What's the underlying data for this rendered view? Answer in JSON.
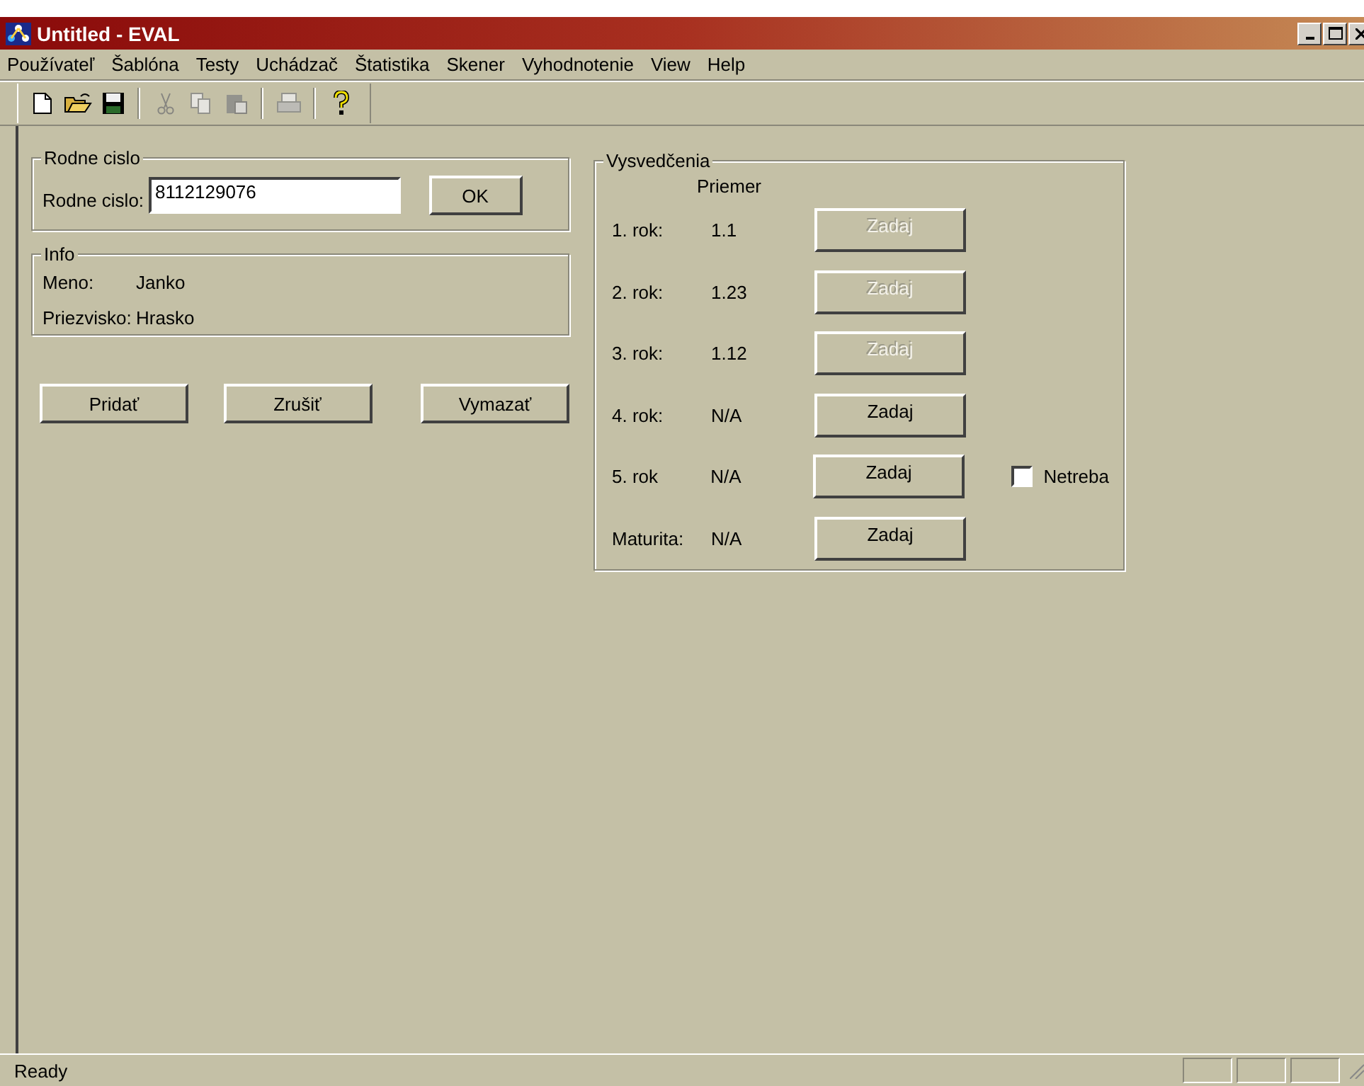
{
  "window": {
    "title": "Untitled - EVAL"
  },
  "menu": [
    "Používateľ",
    "Šablóna",
    "Testy",
    "Uchádzač",
    "Štatistika",
    "Skener",
    "Vyhodnotenie",
    "View",
    "Help"
  ],
  "toolbar": [
    {
      "kind": "new",
      "disabled": false
    },
    {
      "kind": "open",
      "disabled": false
    },
    {
      "kind": "save",
      "disabled": false
    },
    {
      "kind": "cut",
      "disabled": true
    },
    {
      "kind": "copy",
      "disabled": true
    },
    {
      "kind": "paste",
      "disabled": true
    },
    {
      "kind": "print",
      "disabled": true
    },
    {
      "kind": "help",
      "disabled": false
    }
  ],
  "rodne_cislo": {
    "title": "Rodne cislo",
    "label": "Rodne cislo:",
    "value": "8112129076",
    "button": "OK"
  },
  "info": {
    "title": "Info",
    "fields": [
      {
        "label": "Meno:",
        "value": "Janko"
      },
      {
        "label": "Priezvisko:",
        "value": "Hrasko"
      }
    ]
  },
  "actions": [
    "Pridať",
    "Zrušiť",
    "Vymazať"
  ],
  "vysvedcenia": {
    "title": "Vysvedčenia",
    "column": "Priemer",
    "rows": [
      {
        "label": "1. rok:",
        "value": "1.1",
        "button": "Zadaj",
        "disabled": true
      },
      {
        "label": "2. rok:",
        "value": "1.23",
        "button": "Zadaj",
        "disabled": true
      },
      {
        "label": "3. rok:",
        "value": "1.12",
        "button": "Zadaj",
        "disabled": true
      },
      {
        "label": "4. rok:",
        "value": "N/A",
        "button": "Zadaj",
        "disabled": false
      },
      {
        "label": "5. rok",
        "value": "N/A",
        "button": "Zadaj",
        "disabled": false,
        "checkbox": {
          "label": "Netreba",
          "checked": false
        }
      },
      {
        "label": "Maturita:",
        "value": "N/A",
        "button": "Zadaj",
        "disabled": false
      }
    ]
  },
  "status_bar": {
    "text": "Ready"
  }
}
